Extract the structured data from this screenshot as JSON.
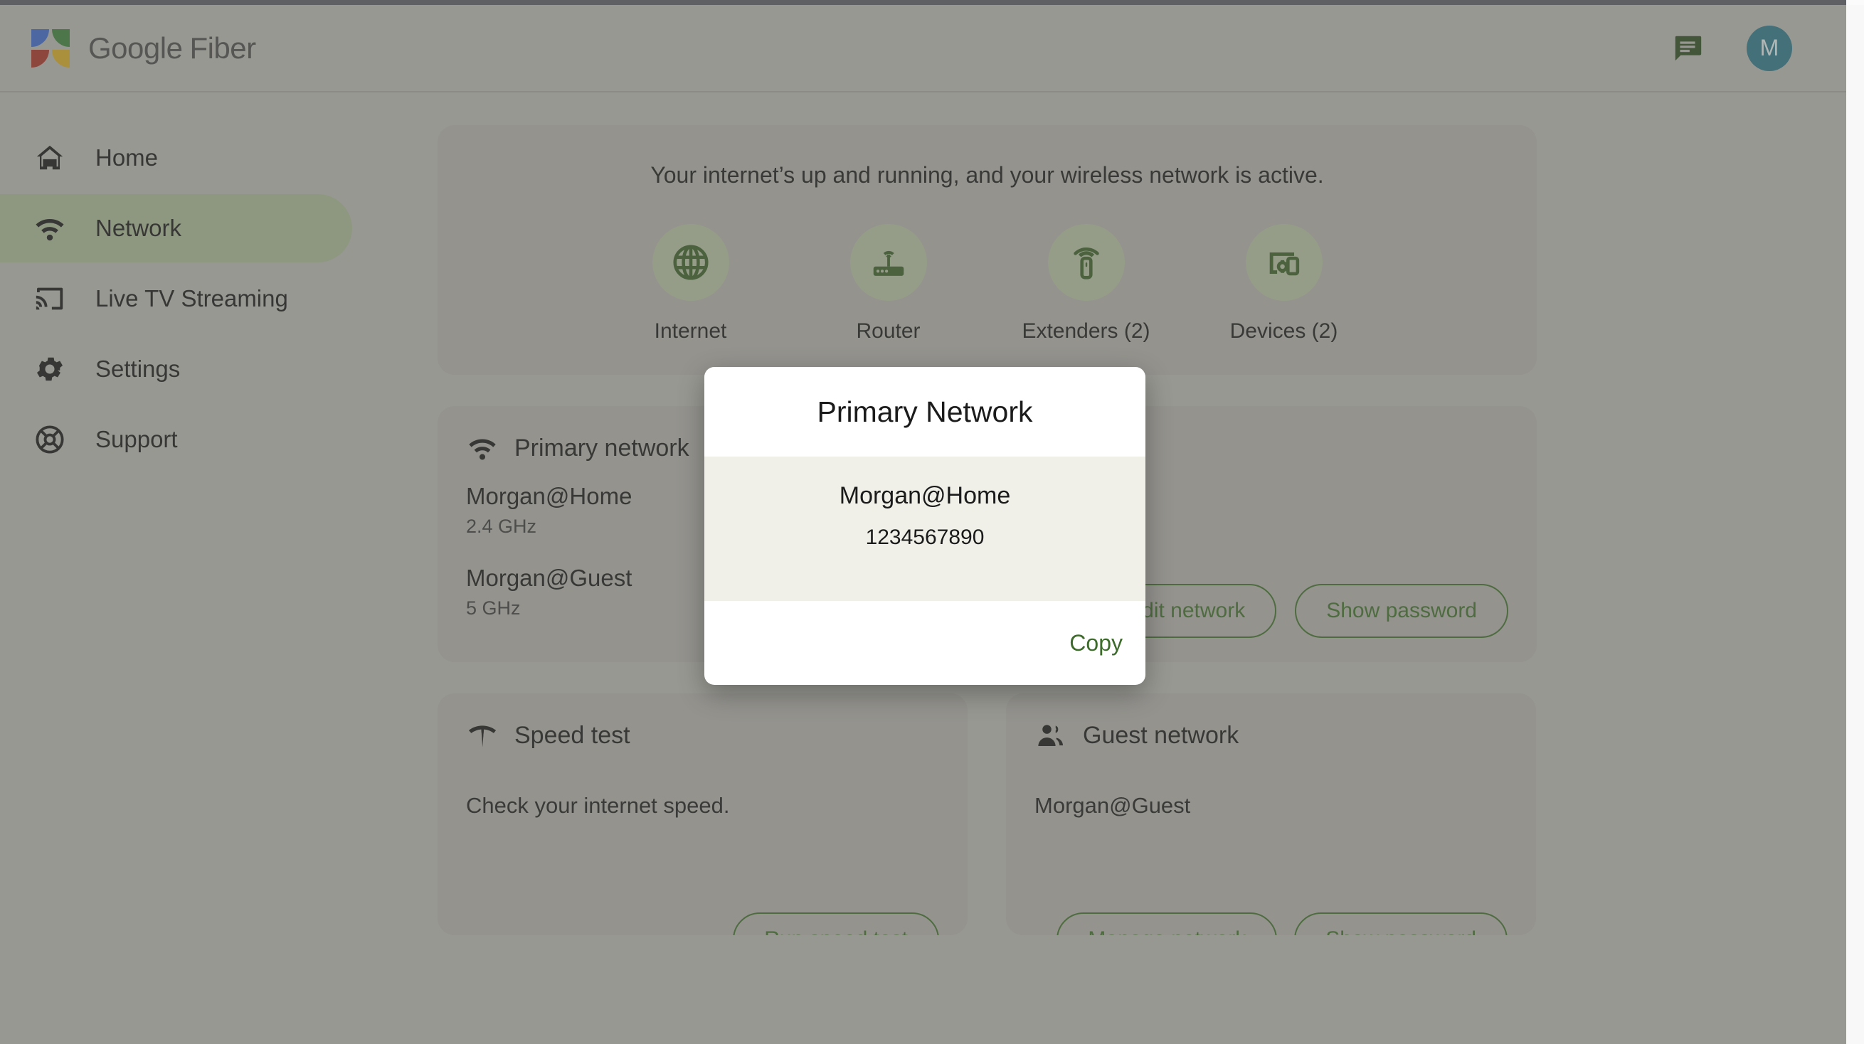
{
  "app": {
    "brand_google": "Google",
    "brand_fiber": "Fiber",
    "logo_icon": "google-fiber-logo"
  },
  "header": {
    "chat_icon": "chat-bubble-icon",
    "avatar_initial": "M"
  },
  "sidebar": {
    "items": [
      {
        "label": "Home",
        "icon": "home-icon",
        "active": false
      },
      {
        "label": "Network",
        "icon": "wifi-icon",
        "active": true
      },
      {
        "label": "Live TV Streaming",
        "icon": "cast-icon",
        "active": false
      },
      {
        "label": "Settings",
        "icon": "gear-icon",
        "active": false
      },
      {
        "label": "Support",
        "icon": "lifebuoy-icon",
        "active": false
      }
    ]
  },
  "status": {
    "message": "Your internet’s up and running, and your wireless network is active.",
    "items": [
      {
        "label": "Internet",
        "icon": "globe-icon"
      },
      {
        "label": "Router",
        "icon": "router-icon"
      },
      {
        "label": "Extenders (2)",
        "icon": "extender-icon"
      },
      {
        "label": "Devices (2)",
        "icon": "devices-icon"
      }
    ]
  },
  "primary_network": {
    "title": "Primary network",
    "icon": "wifi-icon",
    "networks": [
      {
        "ssid": "Morgan@Home",
        "band": "2.4 GHz"
      },
      {
        "ssid": "Morgan@Guest",
        "band": "5 GHz"
      }
    ],
    "edit_label": "Edit network",
    "show_password_label": "Show password"
  },
  "speed_test": {
    "title": "Speed test",
    "icon": "network-speed-icon",
    "description": "Check your internet speed.",
    "run_label": "Run speed test"
  },
  "guest_network": {
    "title": "Guest network",
    "icon": "people-icon",
    "ssid": "Morgan@Guest",
    "manage_label": "Manage network",
    "show_password_label": "Show password"
  },
  "modal": {
    "title": "Primary Network",
    "ssid": "Morgan@Home",
    "password": "1234567890",
    "copy_label": "Copy"
  },
  "colors": {
    "accent_green": "#3d6b2b",
    "nav_active": "#9fae8e",
    "icon_bubble": "#a9b598",
    "avatar": "#2e7183",
    "page_bg": "#aeada8",
    "card_bg": "#a7a6a1",
    "modal_body": "#f0f0e8"
  }
}
